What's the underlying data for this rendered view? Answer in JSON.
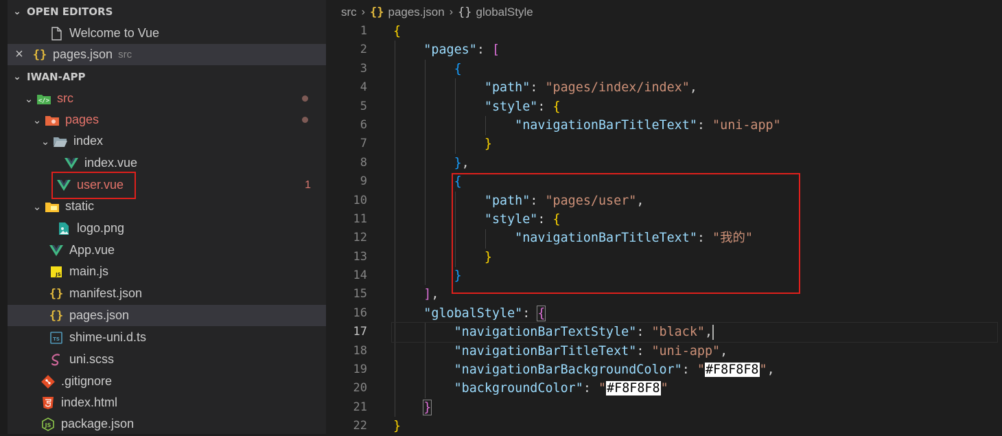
{
  "sidebar": {
    "open_editors": {
      "header": "OPEN EDITORS",
      "items": [
        {
          "label": "Welcome to Vue",
          "desc": ""
        },
        {
          "label": "pages.json",
          "desc": "src"
        }
      ]
    },
    "project": {
      "header": "IWAN-APP",
      "tree": [
        {
          "label": "src"
        },
        {
          "label": "pages"
        },
        {
          "label": "index"
        },
        {
          "label": "index.vue"
        },
        {
          "label": "user.vue",
          "badge": "1"
        },
        {
          "label": "static"
        },
        {
          "label": "logo.png"
        },
        {
          "label": "App.vue"
        },
        {
          "label": "main.js"
        },
        {
          "label": "manifest.json"
        },
        {
          "label": "pages.json"
        },
        {
          "label": "shime-uni.d.ts"
        },
        {
          "label": "uni.scss"
        },
        {
          "label": ".gitignore"
        },
        {
          "label": "index.html"
        },
        {
          "label": "package.json"
        }
      ]
    }
  },
  "breadcrumb": {
    "items": [
      "src",
      "pages.json",
      "globalStyle"
    ],
    "icons": [
      "{}",
      "{}"
    ]
  },
  "editor": {
    "line_numbers": [
      "1",
      "2",
      "3",
      "4",
      "5",
      "6",
      "7",
      "8",
      "9",
      "10",
      "11",
      "12",
      "13",
      "14",
      "15",
      "16",
      "17",
      "18",
      "19",
      "20",
      "21",
      "22"
    ],
    "current_line": "17",
    "code": {
      "l2_key": "\"pages\"",
      "l4_key": "\"path\"",
      "l4_val": "\"pages/index/index\"",
      "l5_key": "\"style\"",
      "l6_key": "\"navigationBarTitleText\"",
      "l6_val": "\"uni-app\"",
      "l10_key": "\"path\"",
      "l10_val": "\"pages/user\"",
      "l11_key": "\"style\"",
      "l12_key": "\"navigationBarTitleText\"",
      "l12_val": "\"我的\"",
      "l16_key": "\"globalStyle\"",
      "l17_key": "\"navigationBarTextStyle\"",
      "l17_val": "\"black\"",
      "l18_key": "\"navigationBarTitleText\"",
      "l18_val": "\"uni-app\"",
      "l19_key": "\"navigationBarBackgroundColor\"",
      "l19_val": "#F8F8F8",
      "l20_key": "\"backgroundColor\"",
      "l20_val": "#F8F8F8"
    }
  },
  "colors": {
    "modified": "#e4736a",
    "json_icon": "#e2b93d",
    "vue_icon": "#41b883",
    "annotation_box": "#e0201c"
  }
}
